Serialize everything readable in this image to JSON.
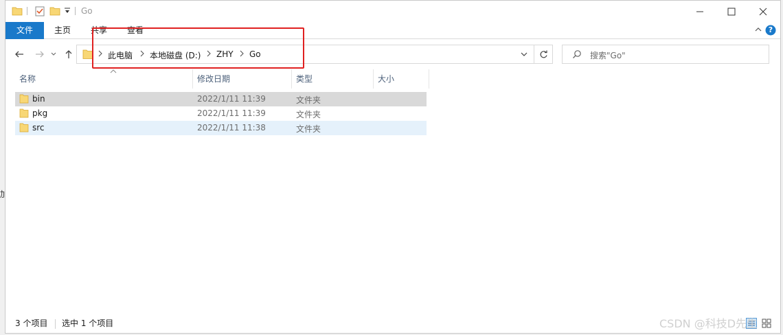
{
  "window": {
    "title": "Go"
  },
  "ribbon": {
    "tabs": [
      "文件",
      "主页",
      "共享",
      "查看"
    ],
    "help_glyph": "?"
  },
  "address": {
    "crumbs": [
      "此电脑",
      "本地磁盘 (D:)",
      "ZHY",
      "Go"
    ]
  },
  "search": {
    "placeholder": "搜索\"Go\""
  },
  "columns": {
    "name": "名称",
    "modified": "修改日期",
    "type": "类型",
    "size": "大小"
  },
  "files": [
    {
      "name": "bin",
      "modified": "2022/1/11 11:39",
      "type": "文件夹"
    },
    {
      "name": "pkg",
      "modified": "2022/1/11 11:39",
      "type": "文件夹"
    },
    {
      "name": "src",
      "modified": "2022/1/11 11:38",
      "type": "文件夹"
    }
  ],
  "status": {
    "item_count": "3 个项目",
    "selected_count": "选中 1 个项目"
  },
  "left_edge_fragment": "加",
  "watermark": "CSDN @科技D先生",
  "colors": {
    "accent": "#1979ca",
    "annotation": "#e02020",
    "folder": "#f8d775",
    "selection": "#e5f1fb",
    "hover": "#d9d9d9"
  }
}
